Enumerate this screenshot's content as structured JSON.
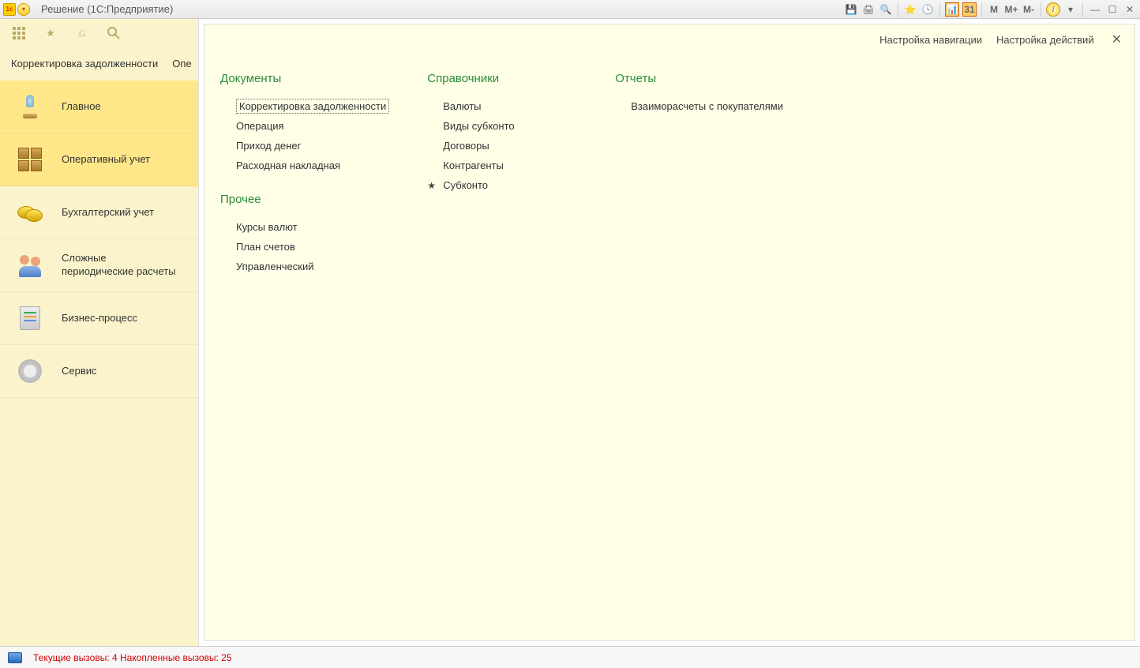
{
  "titlebar": {
    "title": "Решение  (1С:Предприятие)",
    "calc_m": "M",
    "calc_mplus": "M+",
    "calc_mminus": "M-"
  },
  "breadcrumb": {
    "first": "Корректировка задолженности",
    "second": "Опе"
  },
  "nav": {
    "items": [
      {
        "label": "Главное"
      },
      {
        "label": "Оперативный учет"
      },
      {
        "label": "Бухгалтерский учет"
      },
      {
        "label": "Сложные периодические расчеты"
      },
      {
        "label": "Бизнес-процесс"
      },
      {
        "label": "Сервис"
      }
    ]
  },
  "panel_top": {
    "nav_settings": "Настройка навигации",
    "actions_settings": "Настройка действий"
  },
  "sections": {
    "documents": {
      "title": "Документы",
      "items": [
        "Корректировка задолженности",
        "Операция",
        "Приход денег",
        "Расходная накладная"
      ]
    },
    "other": {
      "title": "Прочее",
      "items": [
        "Курсы валют",
        "План счетов",
        "Управленческий"
      ]
    },
    "references": {
      "title": "Справочники",
      "items": [
        "Валюты",
        "Виды субконто",
        "Договоры",
        "Контрагенты",
        "Субконто"
      ]
    },
    "reports": {
      "title": "Отчеты",
      "items": [
        "Взаиморасчеты с покупателями"
      ]
    }
  },
  "status": {
    "text": "Текущие вызовы: 4  Накопленные вызовы: 25"
  }
}
